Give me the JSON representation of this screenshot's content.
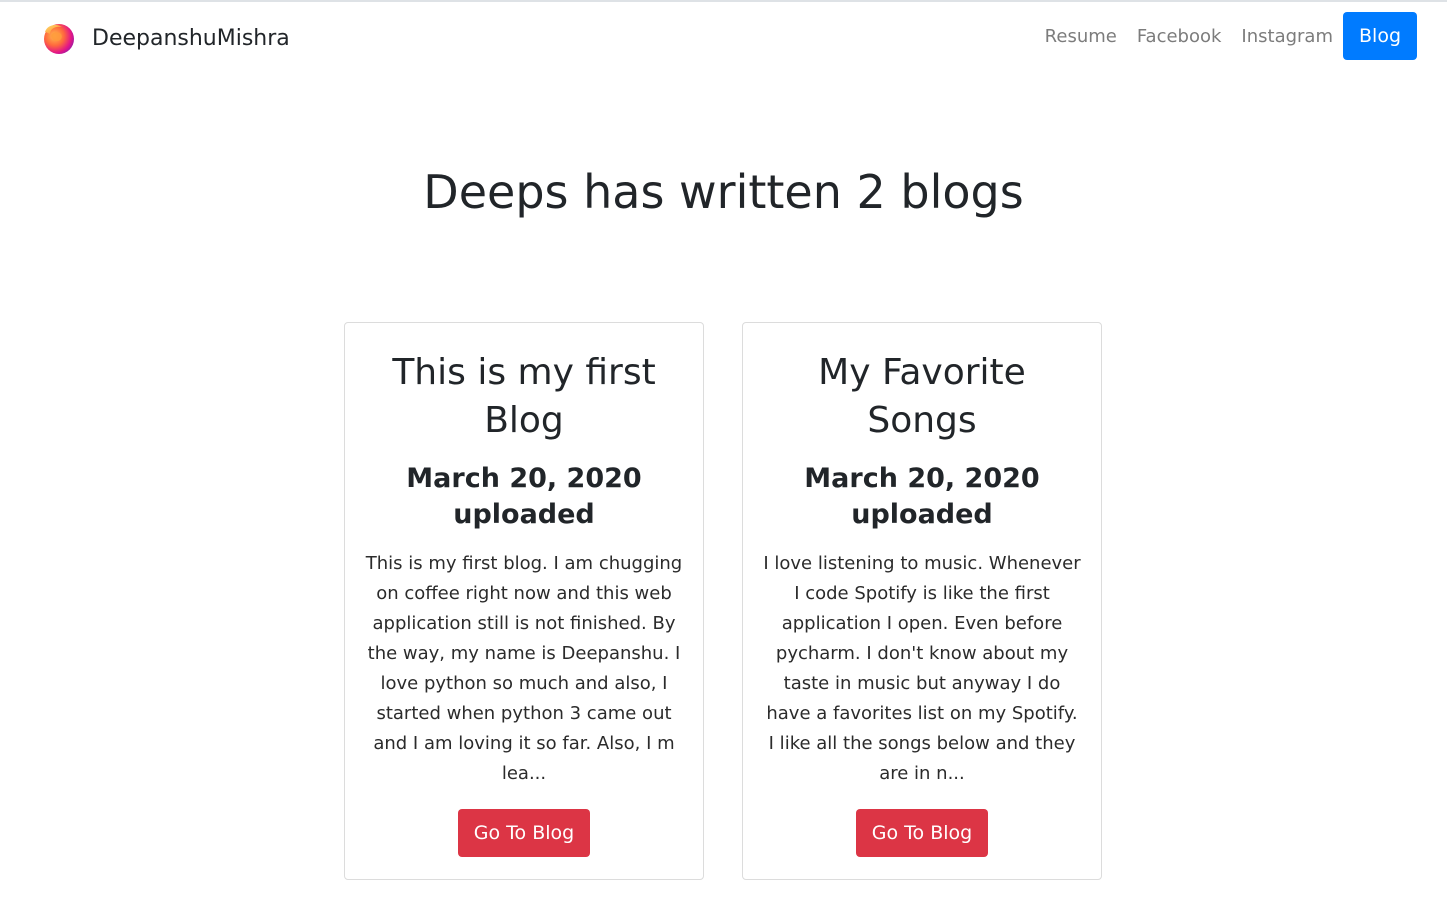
{
  "navbar": {
    "brand": "DeepanshuMishra",
    "links": [
      "Resume",
      "Facebook",
      "Instagram"
    ],
    "active_button": "Blog"
  },
  "page": {
    "title": "Deeps has written 2 blogs"
  },
  "cards": [
    {
      "title": "This is my first Blog",
      "date": "March 20, 2020 uploaded",
      "excerpt": "This is my first blog. I am chugging on coffee right now and this web application still is not finished. By the way, my name is Deepanshu. I love python so much and also, I started when python 3 came out and I am loving it so far. Also, I m lea...",
      "button": "Go To Blog"
    },
    {
      "title": "My Favorite Songs",
      "date": "March 20, 2020 uploaded",
      "excerpt": "I love listening to music. Whenever I code Spotify is like the first application I open. Even before pycharm. I don't know about my taste in music but anyway I do have a favorites list on my Spotify. I like all the songs below and they are in n...",
      "button": "Go To Blog"
    }
  ],
  "colors": {
    "primary": "#007bff",
    "danger": "#dc3545",
    "text": "#212529",
    "muted_link": "#7c7c7c"
  },
  "icons": {
    "brand_logo": "firefox-logo-icon"
  }
}
